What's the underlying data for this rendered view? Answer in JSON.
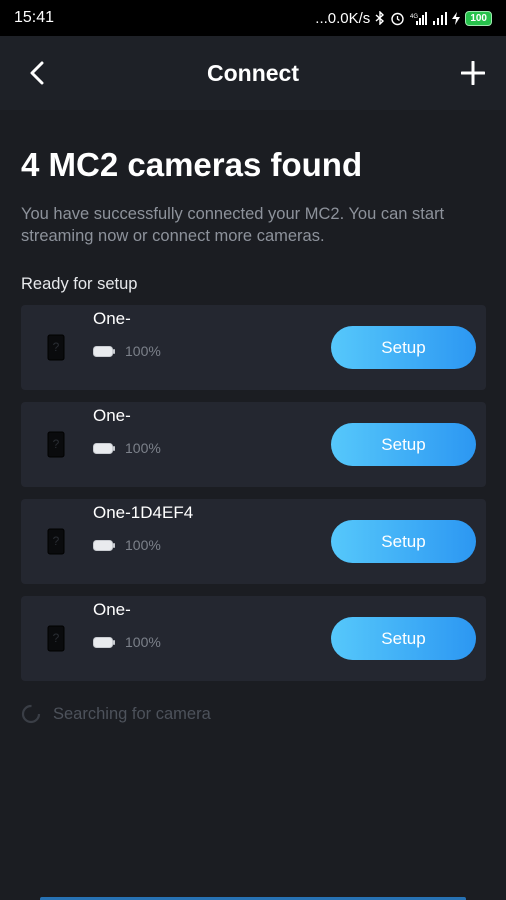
{
  "status_bar": {
    "time": "15:41",
    "network_speed": "...0.0K/s",
    "network_type": "4G",
    "battery_level": "100",
    "icons": [
      "bluetooth-icon",
      "alarm-icon",
      "signal-icon",
      "wifi-icon",
      "charging-icon",
      "battery-icon"
    ]
  },
  "app_bar": {
    "title": "Connect",
    "back_icon": "chevron-left-icon",
    "add_icon": "plus-icon"
  },
  "main": {
    "headline": "4 MC2 cameras found",
    "subtext": "You have successfully connected your MC2. You can start streaming now or connect more cameras.",
    "section_label": "Ready for setup",
    "cameras": [
      {
        "name": "One-",
        "battery": "100%",
        "button": "Setup"
      },
      {
        "name": "One-",
        "battery": "100%",
        "button": "Setup"
      },
      {
        "name": "One-1D4EF4",
        "battery": "100%",
        "button": "Setup"
      },
      {
        "name": "One-",
        "battery": "100%",
        "button": "Setup"
      }
    ],
    "searching_text": "Searching for camera"
  },
  "colors": {
    "background": "#1b1d22",
    "card": "#242730",
    "accent_start": "#56c8fb",
    "accent_end": "#2c97f2",
    "muted_text": "#8d929b"
  }
}
